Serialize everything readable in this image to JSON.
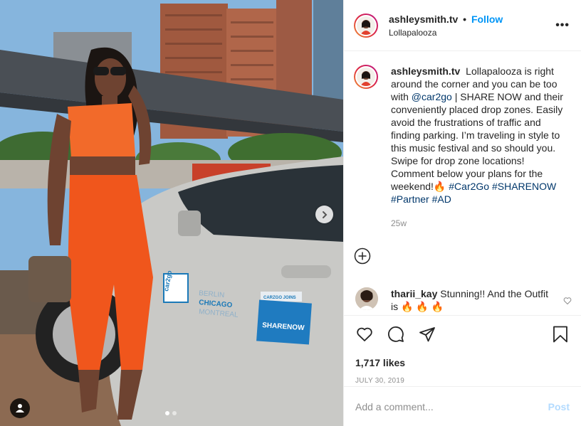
{
  "post": {
    "username": "ashleysmith.tv",
    "bullet": "•",
    "follow_label": "Follow",
    "location": "Lollapalooza",
    "more_label": "•••"
  },
  "photo": {
    "car_badge_top": "CARZGO JOINS",
    "car_badge_brand": "SHARENOW",
    "car_cities": [
      "BERLIN",
      "CHICAGO",
      "MONTREAL"
    ],
    "car_logo_text": "car2go",
    "carousel_count": 2,
    "carousel_active": 1
  },
  "caption": {
    "username": "ashleysmith.tv",
    "part1": "Lollapalooza is right around the corner and you can be too with",
    "mention": "@car2go",
    "part2": "| SHARE NOW and their conveniently placed drop zones. Easily avoid the frustrations of traffic and finding parking. I’m traveling in style to this music festival and so should you. Swipe for drop zone locations! Comment below your plans for the weekend!🔥",
    "tag1": "#Car2Go",
    "tag2": "#SHARENOW",
    "tag3": "#Partner",
    "tag4": "#AD",
    "time": "25w"
  },
  "comment": {
    "username": "tharii_kay",
    "text": "Stunning!! And the Outfit is 🔥 🔥 🔥"
  },
  "stats": {
    "likes": "1,717 likes",
    "date": "JULY 30, 2019"
  },
  "composer": {
    "placeholder": "Add a comment...",
    "post_label": "Post"
  },
  "colors": {
    "accent": "#0095f6",
    "post_disabled": "#b3dbff",
    "muted": "#8e8e8e",
    "outfit": "#f0561c"
  }
}
